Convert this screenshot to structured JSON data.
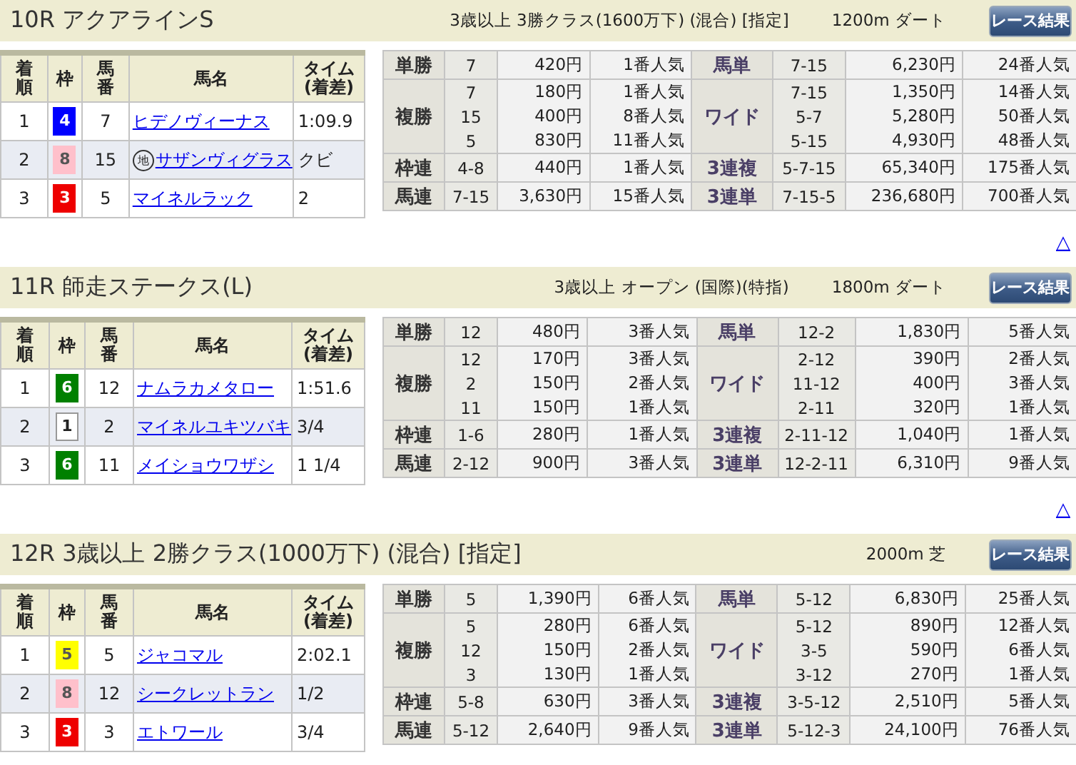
{
  "races": [
    {
      "title": "10R アクアラインS",
      "conditions": "3歳以上 3勝クラス(1600万下) (混合) [指定]",
      "distance": "1200m",
      "surface": "ダート",
      "button": "レース結果",
      "columns": [
        "着順",
        "枠",
        "馬番",
        "馬名",
        "タイム\n(着差)"
      ],
      "rows": [
        {
          "place": "1",
          "frame": "4",
          "color": "#0000ff",
          "number": "7",
          "horse": "ヒデノヴィーナス",
          "time": "1:09.9"
        },
        {
          "place": "2",
          "frame": "8",
          "color": "#ffc0cb",
          "number": "15",
          "mark": "地",
          "horse": "サザンヴィグラス",
          "time": "クビ"
        },
        {
          "place": "3",
          "frame": "3",
          "color": "#ee0000",
          "number": "5",
          "horse": "マイネルラック",
          "time": "2"
        }
      ],
      "payouts_left": [
        {
          "type": "単勝",
          "entries": [
            {
              "combo": "7",
              "amount": "420円",
              "popularity": "1番人気"
            }
          ]
        },
        {
          "type": "複勝",
          "entries": [
            {
              "combo": "7",
              "amount": "180円",
              "popularity": "1番人気"
            },
            {
              "combo": "15",
              "amount": "400円",
              "popularity": "8番人気"
            },
            {
              "combo": "5",
              "amount": "830円",
              "popularity": "11番人気"
            }
          ]
        },
        {
          "type": "枠連",
          "entries": [
            {
              "combo": "4-8",
              "amount": "440円",
              "popularity": "1番人気"
            }
          ]
        },
        {
          "type": "馬連",
          "entries": [
            {
              "combo": "7-15",
              "amount": "3,630円",
              "popularity": "15番人気"
            }
          ]
        }
      ],
      "payouts_right": [
        {
          "type": "馬単",
          "entries": [
            {
              "combo": "7-15",
              "amount": "6,230円",
              "popularity": "24番人気"
            }
          ]
        },
        {
          "type": "ワイド",
          "entries": [
            {
              "combo": "7-15",
              "amount": "1,350円",
              "popularity": "14番人気"
            },
            {
              "combo": "5-7",
              "amount": "5,280円",
              "popularity": "50番人気"
            },
            {
              "combo": "5-15",
              "amount": "4,930円",
              "popularity": "48番人気"
            }
          ]
        },
        {
          "type": "3連複",
          "entries": [
            {
              "combo": "5-7-15",
              "amount": "65,340円",
              "popularity": "175番人気"
            }
          ]
        },
        {
          "type": "3連単",
          "entries": [
            {
              "combo": "7-15-5",
              "amount": "236,680円",
              "popularity": "700番人気"
            }
          ]
        }
      ],
      "top_link": "△"
    },
    {
      "title": "11R 師走ステークス(L)",
      "conditions": "3歳以上 オープン (国際)(特指)",
      "distance": "1800m",
      "surface": "ダート",
      "button": "レース結果",
      "columns": [
        "着順",
        "枠",
        "馬番",
        "馬名",
        "タイム\n(着差)"
      ],
      "rows": [
        {
          "place": "1",
          "frame": "6",
          "color": "#008000",
          "number": "12",
          "horse": "ナムラカメタロー",
          "time": "1:51.6"
        },
        {
          "place": "2",
          "frame": "1",
          "color": "#ffffff",
          "number": "2",
          "horse": "マイネルユキツバキ",
          "time": "3/4"
        },
        {
          "place": "3",
          "frame": "6",
          "color": "#008000",
          "number": "11",
          "horse": "メイショウワザシ",
          "time": "1 1/4"
        }
      ],
      "payouts_left": [
        {
          "type": "単勝",
          "entries": [
            {
              "combo": "12",
              "amount": "480円",
              "popularity": "3番人気"
            }
          ]
        },
        {
          "type": "複勝",
          "entries": [
            {
              "combo": "12",
              "amount": "170円",
              "popularity": "3番人気"
            },
            {
              "combo": "2",
              "amount": "150円",
              "popularity": "2番人気"
            },
            {
              "combo": "11",
              "amount": "150円",
              "popularity": "1番人気"
            }
          ]
        },
        {
          "type": "枠連",
          "entries": [
            {
              "combo": "1-6",
              "amount": "280円",
              "popularity": "1番人気"
            }
          ]
        },
        {
          "type": "馬連",
          "entries": [
            {
              "combo": "2-12",
              "amount": "900円",
              "popularity": "3番人気"
            }
          ]
        }
      ],
      "payouts_right": [
        {
          "type": "馬単",
          "entries": [
            {
              "combo": "12-2",
              "amount": "1,830円",
              "popularity": "5番人気"
            }
          ]
        },
        {
          "type": "ワイド",
          "entries": [
            {
              "combo": "2-12",
              "amount": "390円",
              "popularity": "2番人気"
            },
            {
              "combo": "11-12",
              "amount": "400円",
              "popularity": "3番人気"
            },
            {
              "combo": "2-11",
              "amount": "320円",
              "popularity": "1番人気"
            }
          ]
        },
        {
          "type": "3連複",
          "entries": [
            {
              "combo": "2-11-12",
              "amount": "1,040円",
              "popularity": "1番人気"
            }
          ]
        },
        {
          "type": "3連単",
          "entries": [
            {
              "combo": "12-2-11",
              "amount": "6,310円",
              "popularity": "9番人気"
            }
          ]
        }
      ],
      "top_link": "△"
    },
    {
      "title": "12R 3歳以上 2勝クラス(1000万下) (混合) [指定]",
      "distance": "2000m",
      "surface": "芝",
      "button": "レース結果",
      "columns": [
        "着順",
        "枠",
        "馬番",
        "馬名",
        "タイム\n(着差)"
      ],
      "rows": [
        {
          "place": "1",
          "frame": "5",
          "color": "#ffff00",
          "number": "5",
          "horse": "ジャコマル",
          "time": "2:02.1"
        },
        {
          "place": "2",
          "frame": "8",
          "color": "#ffc0cb",
          "number": "12",
          "horse": "シークレットラン",
          "time": "1/2"
        },
        {
          "place": "3",
          "frame": "3",
          "color": "#ee0000",
          "number": "3",
          "horse": "エトワール",
          "time": "3/4"
        }
      ],
      "payouts_left": [
        {
          "type": "単勝",
          "entries": [
            {
              "combo": "5",
              "amount": "1,390円",
              "popularity": "6番人気"
            }
          ]
        },
        {
          "type": "複勝",
          "entries": [
            {
              "combo": "5",
              "amount": "280円",
              "popularity": "6番人気"
            },
            {
              "combo": "12",
              "amount": "150円",
              "popularity": "2番人気"
            },
            {
              "combo": "3",
              "amount": "130円",
              "popularity": "1番人気"
            }
          ]
        },
        {
          "type": "枠連",
          "entries": [
            {
              "combo": "5-8",
              "amount": "630円",
              "popularity": "3番人気"
            }
          ]
        },
        {
          "type": "馬連",
          "entries": [
            {
              "combo": "5-12",
              "amount": "2,640円",
              "popularity": "9番人気"
            }
          ]
        }
      ],
      "payouts_right": [
        {
          "type": "馬単",
          "entries": [
            {
              "combo": "5-12",
              "amount": "6,830円",
              "popularity": "25番人気"
            }
          ]
        },
        {
          "type": "ワイド",
          "entries": [
            {
              "combo": "5-12",
              "amount": "890円",
              "popularity": "12番人気"
            },
            {
              "combo": "3-5",
              "amount": "590円",
              "popularity": "6番人気"
            },
            {
              "combo": "3-12",
              "amount": "270円",
              "popularity": "1番人気"
            }
          ]
        },
        {
          "type": "3連複",
          "entries": [
            {
              "combo": "3-5-12",
              "amount": "2,510円",
              "popularity": "5番人気"
            }
          ]
        },
        {
          "type": "3連単",
          "entries": [
            {
              "combo": "5-12-3",
              "amount": "24,100円",
              "popularity": "76番人気"
            }
          ]
        }
      ]
    }
  ]
}
